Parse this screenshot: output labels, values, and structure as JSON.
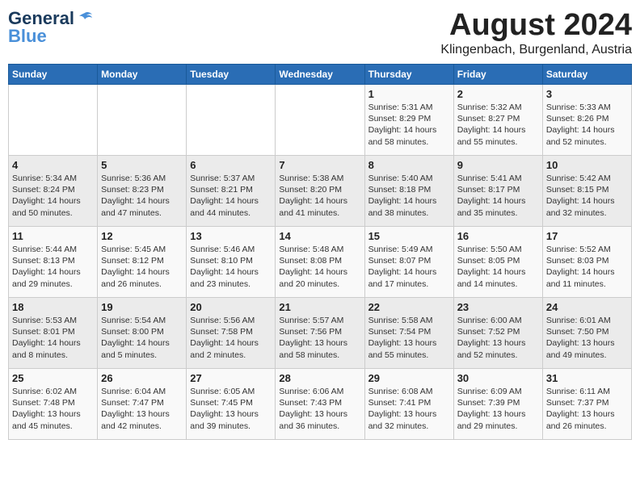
{
  "logo": {
    "line1": "General",
    "line2": "Blue"
  },
  "title": "August 2024",
  "subtitle": "Klingenbach, Burgenland, Austria",
  "days_of_week": [
    "Sunday",
    "Monday",
    "Tuesday",
    "Wednesday",
    "Thursday",
    "Friday",
    "Saturday"
  ],
  "weeks": [
    [
      {
        "day": "",
        "info": ""
      },
      {
        "day": "",
        "info": ""
      },
      {
        "day": "",
        "info": ""
      },
      {
        "day": "",
        "info": ""
      },
      {
        "day": "1",
        "info": "Sunrise: 5:31 AM\nSunset: 8:29 PM\nDaylight: 14 hours\nand 58 minutes."
      },
      {
        "day": "2",
        "info": "Sunrise: 5:32 AM\nSunset: 8:27 PM\nDaylight: 14 hours\nand 55 minutes."
      },
      {
        "day": "3",
        "info": "Sunrise: 5:33 AM\nSunset: 8:26 PM\nDaylight: 14 hours\nand 52 minutes."
      }
    ],
    [
      {
        "day": "4",
        "info": "Sunrise: 5:34 AM\nSunset: 8:24 PM\nDaylight: 14 hours\nand 50 minutes."
      },
      {
        "day": "5",
        "info": "Sunrise: 5:36 AM\nSunset: 8:23 PM\nDaylight: 14 hours\nand 47 minutes."
      },
      {
        "day": "6",
        "info": "Sunrise: 5:37 AM\nSunset: 8:21 PM\nDaylight: 14 hours\nand 44 minutes."
      },
      {
        "day": "7",
        "info": "Sunrise: 5:38 AM\nSunset: 8:20 PM\nDaylight: 14 hours\nand 41 minutes."
      },
      {
        "day": "8",
        "info": "Sunrise: 5:40 AM\nSunset: 8:18 PM\nDaylight: 14 hours\nand 38 minutes."
      },
      {
        "day": "9",
        "info": "Sunrise: 5:41 AM\nSunset: 8:17 PM\nDaylight: 14 hours\nand 35 minutes."
      },
      {
        "day": "10",
        "info": "Sunrise: 5:42 AM\nSunset: 8:15 PM\nDaylight: 14 hours\nand 32 minutes."
      }
    ],
    [
      {
        "day": "11",
        "info": "Sunrise: 5:44 AM\nSunset: 8:13 PM\nDaylight: 14 hours\nand 29 minutes."
      },
      {
        "day": "12",
        "info": "Sunrise: 5:45 AM\nSunset: 8:12 PM\nDaylight: 14 hours\nand 26 minutes."
      },
      {
        "day": "13",
        "info": "Sunrise: 5:46 AM\nSunset: 8:10 PM\nDaylight: 14 hours\nand 23 minutes."
      },
      {
        "day": "14",
        "info": "Sunrise: 5:48 AM\nSunset: 8:08 PM\nDaylight: 14 hours\nand 20 minutes."
      },
      {
        "day": "15",
        "info": "Sunrise: 5:49 AM\nSunset: 8:07 PM\nDaylight: 14 hours\nand 17 minutes."
      },
      {
        "day": "16",
        "info": "Sunrise: 5:50 AM\nSunset: 8:05 PM\nDaylight: 14 hours\nand 14 minutes."
      },
      {
        "day": "17",
        "info": "Sunrise: 5:52 AM\nSunset: 8:03 PM\nDaylight: 14 hours\nand 11 minutes."
      }
    ],
    [
      {
        "day": "18",
        "info": "Sunrise: 5:53 AM\nSunset: 8:01 PM\nDaylight: 14 hours\nand 8 minutes."
      },
      {
        "day": "19",
        "info": "Sunrise: 5:54 AM\nSunset: 8:00 PM\nDaylight: 14 hours\nand 5 minutes."
      },
      {
        "day": "20",
        "info": "Sunrise: 5:56 AM\nSunset: 7:58 PM\nDaylight: 14 hours\nand 2 minutes."
      },
      {
        "day": "21",
        "info": "Sunrise: 5:57 AM\nSunset: 7:56 PM\nDaylight: 13 hours\nand 58 minutes."
      },
      {
        "day": "22",
        "info": "Sunrise: 5:58 AM\nSunset: 7:54 PM\nDaylight: 13 hours\nand 55 minutes."
      },
      {
        "day": "23",
        "info": "Sunrise: 6:00 AM\nSunset: 7:52 PM\nDaylight: 13 hours\nand 52 minutes."
      },
      {
        "day": "24",
        "info": "Sunrise: 6:01 AM\nSunset: 7:50 PM\nDaylight: 13 hours\nand 49 minutes."
      }
    ],
    [
      {
        "day": "25",
        "info": "Sunrise: 6:02 AM\nSunset: 7:48 PM\nDaylight: 13 hours\nand 45 minutes."
      },
      {
        "day": "26",
        "info": "Sunrise: 6:04 AM\nSunset: 7:47 PM\nDaylight: 13 hours\nand 42 minutes."
      },
      {
        "day": "27",
        "info": "Sunrise: 6:05 AM\nSunset: 7:45 PM\nDaylight: 13 hours\nand 39 minutes."
      },
      {
        "day": "28",
        "info": "Sunrise: 6:06 AM\nSunset: 7:43 PM\nDaylight: 13 hours\nand 36 minutes."
      },
      {
        "day": "29",
        "info": "Sunrise: 6:08 AM\nSunset: 7:41 PM\nDaylight: 13 hours\nand 32 minutes."
      },
      {
        "day": "30",
        "info": "Sunrise: 6:09 AM\nSunset: 7:39 PM\nDaylight: 13 hours\nand 29 minutes."
      },
      {
        "day": "31",
        "info": "Sunrise: 6:11 AM\nSunset: 7:37 PM\nDaylight: 13 hours\nand 26 minutes."
      }
    ]
  ]
}
